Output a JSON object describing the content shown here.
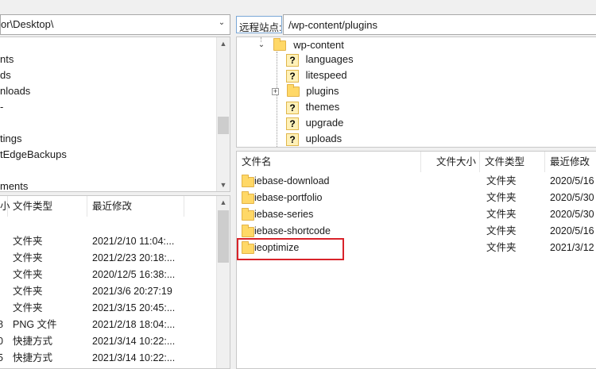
{
  "left_path": {
    "value": "or\\Desktop\\"
  },
  "right_path": {
    "label": "远程站点:",
    "value": "/wp-content/plugins"
  },
  "left_tree": {
    "items": [
      "nts",
      "ds",
      "nloads",
      "-",
      "tings",
      "tEdgeBackups",
      "",
      "ments"
    ]
  },
  "right_tree": {
    "root": "wp-content",
    "items": [
      {
        "label": "languages",
        "icon": "question-folder-icon"
      },
      {
        "label": "litespeed",
        "icon": "question-folder-icon"
      },
      {
        "label": "plugins",
        "icon": "folder-icon"
      },
      {
        "label": "themes",
        "icon": "question-folder-icon"
      },
      {
        "label": "upgrade",
        "icon": "question-folder-icon"
      },
      {
        "label": "uploads",
        "icon": "question-folder-icon"
      }
    ]
  },
  "left_list": {
    "headers": {
      "size_tail": "小",
      "type": "文件类型",
      "modified": "最近修改"
    },
    "rows": [
      {
        "size": "",
        "type": "文件夹",
        "modified": "2021/2/10 11:04:..."
      },
      {
        "size": "",
        "type": "文件夹",
        "modified": "2021/2/23 20:18:..."
      },
      {
        "size": "",
        "type": "文件夹",
        "modified": "2020/12/5 16:38:..."
      },
      {
        "size": "",
        "type": "文件夹",
        "modified": "2021/3/6 20:27:19"
      },
      {
        "size": "",
        "type": "文件夹",
        "modified": "2021/3/15 20:45:..."
      },
      {
        "size": "8",
        "type": "PNG 文件",
        "modified": "2021/2/18 18:04:..."
      },
      {
        "size": "0",
        "type": "快捷方式",
        "modified": "2021/3/14 10:22:..."
      },
      {
        "size": "5",
        "type": "快捷方式",
        "modified": "2021/3/14 10:22:..."
      }
    ]
  },
  "right_list": {
    "headers": {
      "name": "文件名",
      "size": "文件大小",
      "type": "文件类型",
      "modified": "最近修改"
    },
    "rows": [
      {
        "name": "iebase-download",
        "type": "文件夹",
        "modified": "2020/5/16"
      },
      {
        "name": "iebase-portfolio",
        "type": "文件夹",
        "modified": "2020/5/30"
      },
      {
        "name": "iebase-series",
        "type": "文件夹",
        "modified": "2020/5/30"
      },
      {
        "name": "iebase-shortcode",
        "type": "文件夹",
        "modified": "2020/5/16"
      },
      {
        "name": "ieoptimize",
        "type": "文件夹",
        "modified": "2021/3/12"
      }
    ]
  },
  "colors": {
    "highlight": "#d9232a",
    "folder": "#ffd867"
  }
}
